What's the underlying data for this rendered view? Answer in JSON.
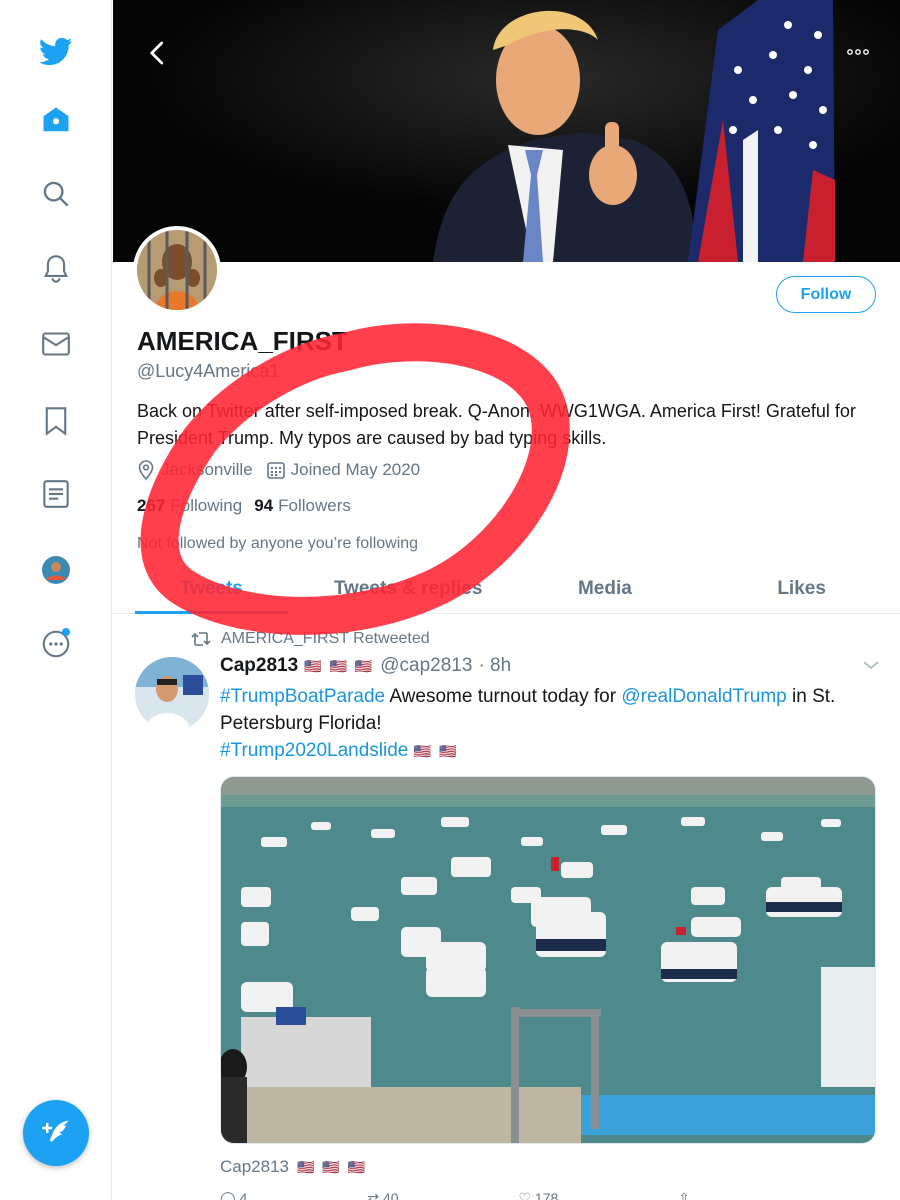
{
  "profile": {
    "display_name": "AMERICA_FIRST",
    "handle": "@Lucy4America1",
    "bio": "Back on Twitter after self-imposed break. Q-Anon. WWG1WGA. America First! Grateful for President Trump. My typos are caused by bad typing skills.",
    "location": "Jacksonville",
    "joined": "Joined May 2020",
    "following_count": "267",
    "following_label": "Following",
    "followers_count": "94",
    "followers_label": "Followers",
    "not_followed": "Not followed by anyone you’re following",
    "follow_button": "Follow"
  },
  "tabs": [
    {
      "label": "Tweets"
    },
    {
      "label": "Tweets & replies"
    },
    {
      "label": "Media"
    },
    {
      "label": "Likes"
    }
  ],
  "tweet": {
    "retweet_label": "AMERICA_FIRST Retweeted",
    "author_name": "Cap2813",
    "author_flags": "🇺🇸 🇺🇸 🇺🇸",
    "author_handle": "@cap2813",
    "time": "· 8h",
    "body_hashtag": "#TrumpBoatParade",
    "body_text1": " Awesome turnout today for ",
    "body_mention": "@realDonaldTrump",
    "body_text2": " in St. Petersburg Florida!",
    "body_hashtag2": "#Trump2020Landslide",
    "body_flags2": "🇺🇸 🇺🇸",
    "caption": "Cap2813",
    "caption_flags": "🇺🇸 🇺🇸 🇺🇸",
    "reply_count": "4",
    "retweet_count": "40",
    "like_count": "178"
  },
  "colors": {
    "accent": "#1da1f2",
    "link": "#1b95e0",
    "muted": "#657786",
    "marker": "#ff2433"
  },
  "icons": [
    "twitter-bird-icon",
    "home-icon",
    "search-icon",
    "bell-icon",
    "mail-icon",
    "bookmark-icon",
    "list-icon",
    "profile-avatar-icon",
    "more-circle-icon",
    "compose-icon",
    "back-arrow-icon",
    "more-dots-icon",
    "location-icon",
    "calendar-icon",
    "retweet-icon",
    "chevron-down-icon",
    "reply-icon",
    "like-icon",
    "share-icon"
  ]
}
